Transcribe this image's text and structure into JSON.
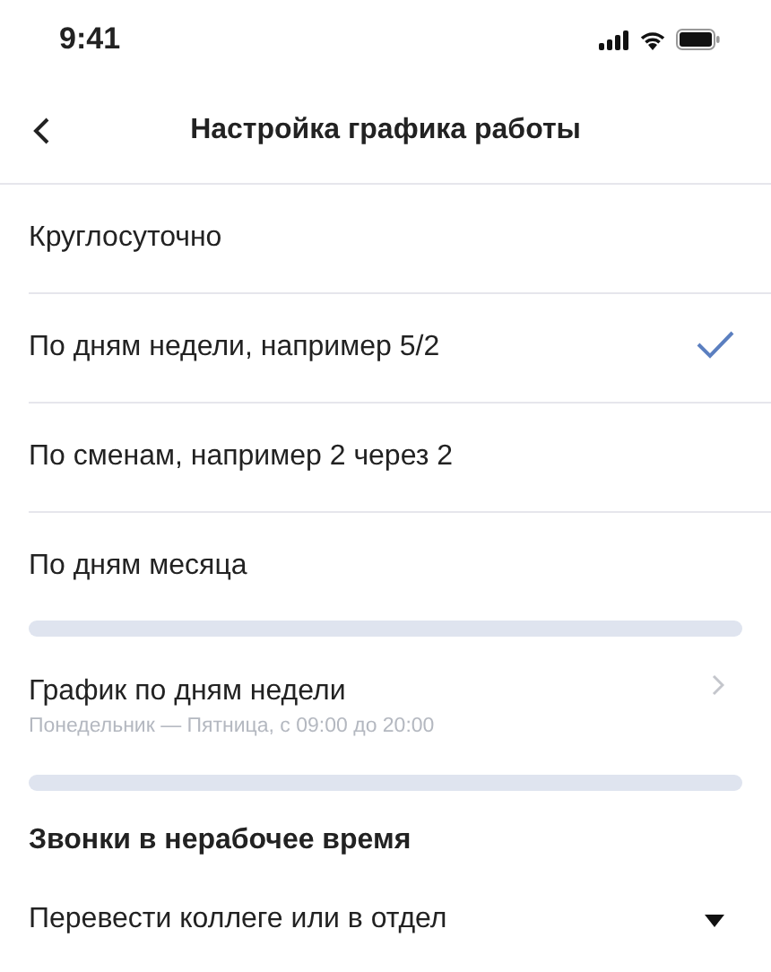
{
  "status_bar": {
    "time": "9:41"
  },
  "header": {
    "title": "Настройка графика работы"
  },
  "schedule_types": [
    {
      "label": "Круглосуточно",
      "selected": false
    },
    {
      "label": "По дням недели, например 5/2",
      "selected": true
    },
    {
      "label": "По сменам, например 2 через 2",
      "selected": false
    },
    {
      "label": "По дням месяца",
      "selected": false
    }
  ],
  "schedule_link": {
    "title": "График по дням недели",
    "subtitle": "Понедельник — Пятница, с 09:00 до 20:00"
  },
  "after_hours": {
    "heading": "Звонки в нерабочее время",
    "value": "Перевести коллеге или в отдел"
  }
}
